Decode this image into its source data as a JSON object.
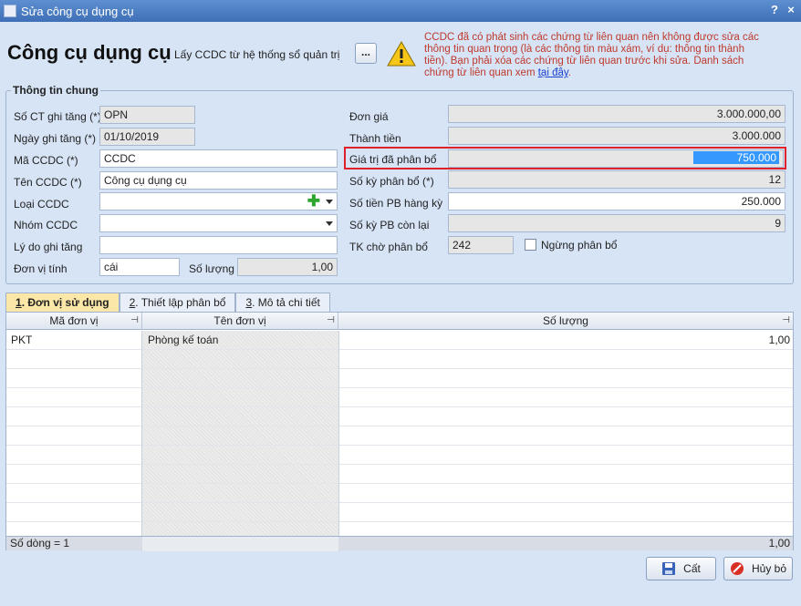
{
  "window": {
    "title": "Sửa công cụ dụng cụ",
    "help": "?",
    "close": "×"
  },
  "header": {
    "title": "Công cụ dụng cụ",
    "lay_label": "Lấy CCDC từ hệ thống sổ quản trị",
    "dots": "...",
    "warning_text": "CCDC đã có phát sinh các chứng từ liên quan nên không được sửa các thông tin quan trọng (là các thông tin màu xám, ví dụ: thông tin thành tiền). Bạn phải xóa các chứng từ liên quan trước khi sửa. Danh sách chứng từ liên quan xem",
    "warning_link": "tại đây",
    "warning_end": "."
  },
  "group": {
    "title": "Thông tin chung"
  },
  "left": {
    "so_ct_label": "Số CT ghi tăng (*)",
    "so_ct_value": "OPN",
    "ngay_label": "Ngày ghi tăng (*)",
    "ngay_value": "01/10/2019",
    "ma_label": "Mã CCDC (*)",
    "ma_value": "CCDC",
    "ten_label": "Tên CCDC (*)",
    "ten_value": "Công cụ dụng cụ",
    "loai_label": "Loại CCDC",
    "loai_value": "",
    "nhom_label": "Nhóm CCDC",
    "nhom_value": "",
    "lydo_label": "Lý do ghi tăng",
    "lydo_value": "",
    "dvt_label": "Đơn vị tính",
    "dvt_value": "cái",
    "sl_label": "Số lượng",
    "sl_value": "1,00"
  },
  "right": {
    "dongia_label": "Đơn giá",
    "dongia_value": "3.000.000,00",
    "thanhtien_label": "Thành tiền",
    "thanhtien_value": "3.000.000",
    "gtpb_label": "Giá trị đã phân bổ",
    "gtpb_value": "750.000",
    "soky_label": "Số kỳ phân bổ (*)",
    "soky_value": "12",
    "sotien_label": "Số tiền PB hàng kỳ",
    "sotien_value": "250.000",
    "conlai_label": "Số kỳ PB còn lại",
    "conlai_value": "9",
    "tk_label": "TK chờ phân bổ",
    "tk_value": "242",
    "ngung_label": "Ngừng phân bổ"
  },
  "tabs": [
    {
      "num": "1",
      "label": ". Đơn vị sử dụng"
    },
    {
      "num": "2",
      "label": ". Thiết lập phân bổ"
    },
    {
      "num": "3",
      "label": ". Mô tả chi tiết"
    }
  ],
  "grid": {
    "columns": [
      "Mã đơn vị",
      "Tên đơn vị",
      "Số lượng"
    ],
    "rows": [
      {
        "ma": "PKT",
        "ten": "Phòng kế toán",
        "sl": "1,00"
      }
    ],
    "footer_count": "Số dòng = 1",
    "footer_total": "1,00"
  },
  "buttons": {
    "save": "Cất",
    "cancel": "Hủy bỏ"
  }
}
